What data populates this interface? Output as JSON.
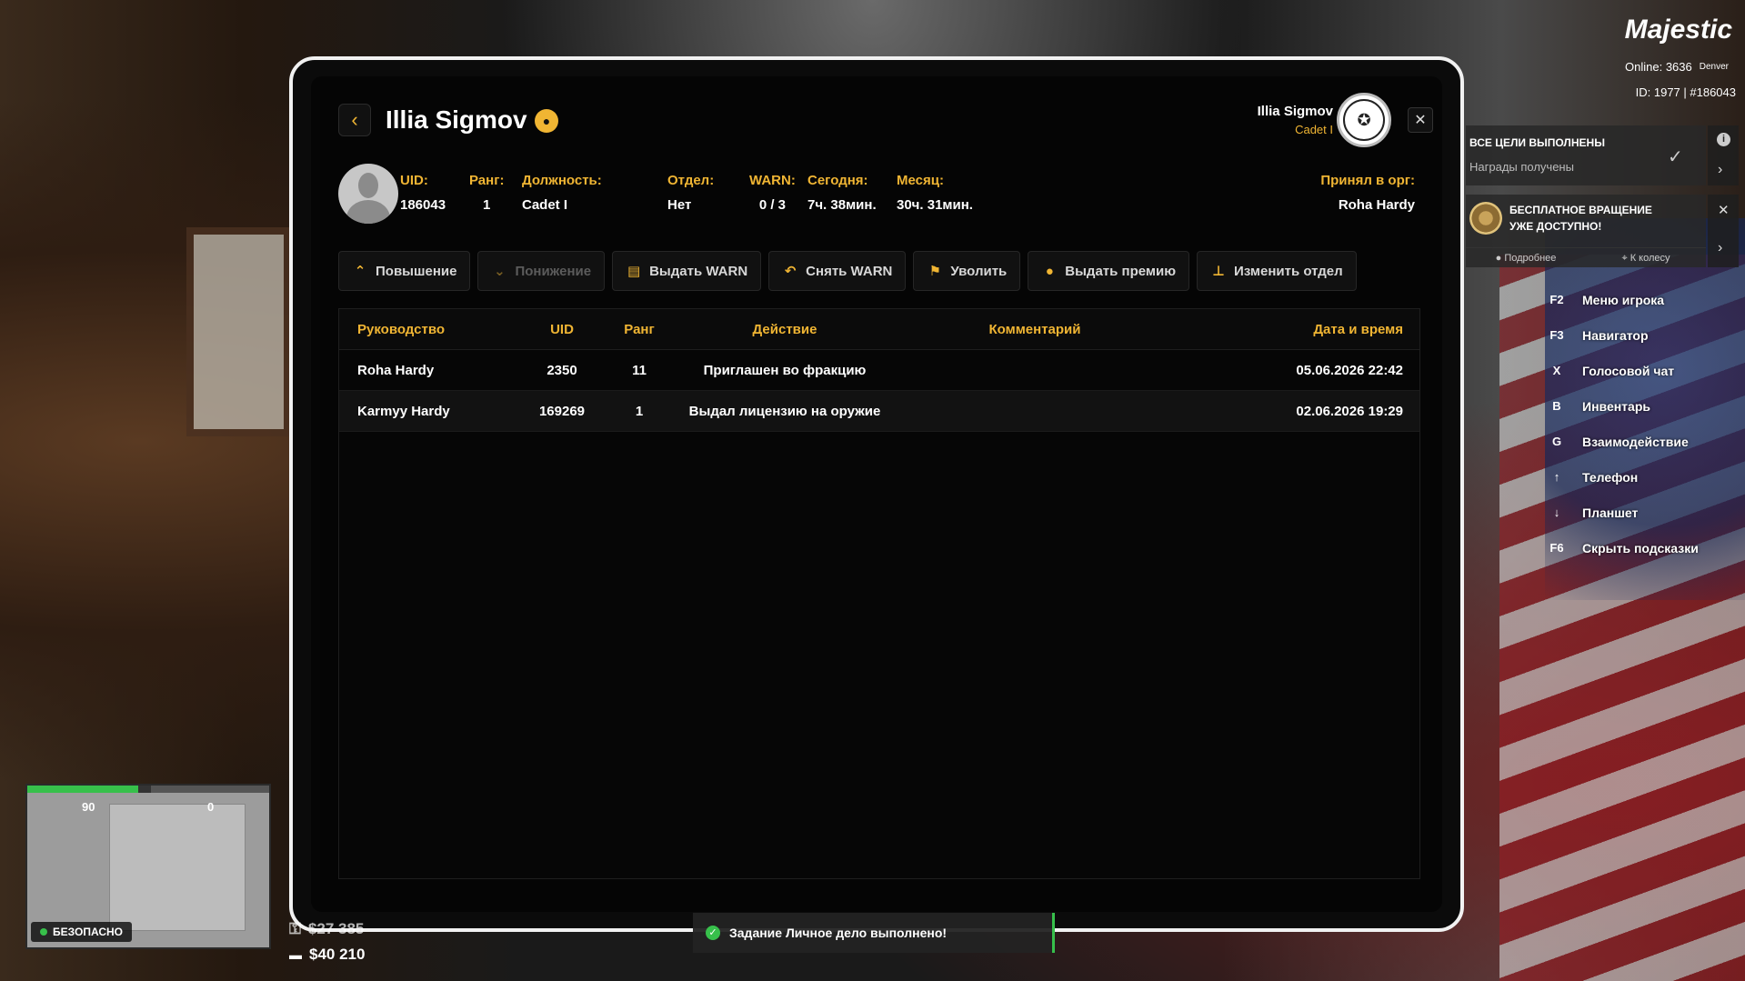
{
  "tablet": {
    "player_name": "Illia Sigmov",
    "header_user": {
      "name": "Illia Sigmov",
      "rank": "Cadet I"
    },
    "info": [
      {
        "label": "UID:",
        "value": "186043"
      },
      {
        "label": "Ранг:",
        "value": "1"
      },
      {
        "label": "Должность:",
        "value": "Cadet I"
      },
      {
        "label": "Отдел:",
        "value": "Нет"
      },
      {
        "label": "WARN:",
        "value": "0 / 3"
      },
      {
        "label": "Сегодня:",
        "value": "7ч. 38мин."
      },
      {
        "label": "Месяц:",
        "value": "30ч. 31мин."
      },
      {
        "label": "Принял в орг:",
        "value": "Roha Hardy"
      }
    ],
    "actions": [
      {
        "label": "Повышение",
        "icon": "chevron-up-icon",
        "disabled": false
      },
      {
        "label": "Понижение",
        "icon": "chevron-down-icon",
        "disabled": true
      },
      {
        "label": "Выдать WARN",
        "icon": "warn-file-icon",
        "disabled": false
      },
      {
        "label": "Снять WARN",
        "icon": "undo-icon",
        "disabled": false
      },
      {
        "label": "Уволить",
        "icon": "fire-person-icon",
        "disabled": false
      },
      {
        "label": "Выдать премию",
        "icon": "coin-icon",
        "disabled": false
      },
      {
        "label": "Изменить отдел",
        "icon": "org-chart-icon",
        "disabled": false
      }
    ],
    "table": {
      "headers": [
        "Руководство",
        "UID",
        "Ранг",
        "Действие",
        "Комментарий",
        "Дата и время"
      ],
      "rows": [
        [
          "Roha Hardy",
          "2350",
          "11",
          "Приглашен во фракцию",
          "",
          "05.06.2026 22:42"
        ],
        [
          "Karmyy Hardy",
          "169269",
          "1",
          "Выдал лицензию на оружие",
          "",
          "02.06.2026 19:29"
        ]
      ]
    }
  },
  "hud": {
    "logo": "Majestic",
    "online": "Online: 3636",
    "server": "Denver",
    "id": "ID: 1977 | #186043",
    "goals": {
      "title": "ВСЕ ЦЕЛИ ВЫПОЛНЕНЫ",
      "subtitle": "Награды получены"
    },
    "spin": {
      "title": "БЕСПЛАТНОЕ ВРАЩЕНИЕ УЖЕ ДОСТУПНО!",
      "more": "Подробнее",
      "wheel": "К колесу"
    },
    "hints": [
      {
        "key": "F2",
        "label": "Меню игрока"
      },
      {
        "key": "F3",
        "label": "Навигатор"
      },
      {
        "key": "X",
        "label": "Голосовой чат"
      },
      {
        "key": "B",
        "label": "Инвентарь"
      },
      {
        "key": "G",
        "label": "Взаимодействие"
      },
      {
        "key": "↑",
        "label": "Телефон"
      },
      {
        "key": "↓",
        "label": "Планшет"
      },
      {
        "key": "F6",
        "label": "Скрыть подсказки"
      }
    ],
    "health": "90",
    "armor": "0",
    "zone": "БЕЗОПАСНО",
    "cash_top": "$27 385",
    "cash_bank": "$40 210",
    "notification": "Задание Личное дело выполнено!"
  },
  "colors": {
    "accent": "#f0b533",
    "success": "#37c04b"
  }
}
